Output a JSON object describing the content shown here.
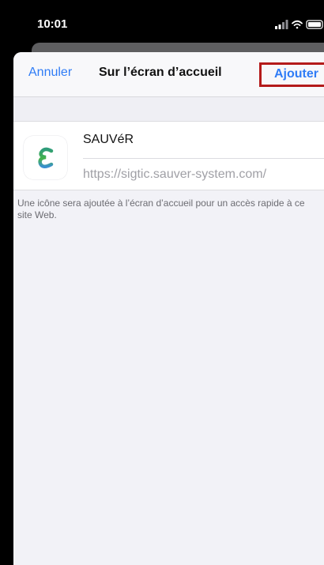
{
  "status_bar": {
    "time": "10:01"
  },
  "nav": {
    "cancel_label": "Annuler",
    "title": "Sur l’écran d’accueil",
    "add_label": "Ajouter"
  },
  "entry": {
    "name": "SAUVéR",
    "url": "https://sigtic.sauver-system.com/",
    "icon": "sauver-logo-icon"
  },
  "footer_note": "Une icône sera ajoutée à l’écran d’accueil pour un accès rapide à ce site Web.",
  "colors": {
    "accent": "#2f7cf6",
    "highlight_box": "#b41a1a",
    "background": "#f2f2f7"
  }
}
